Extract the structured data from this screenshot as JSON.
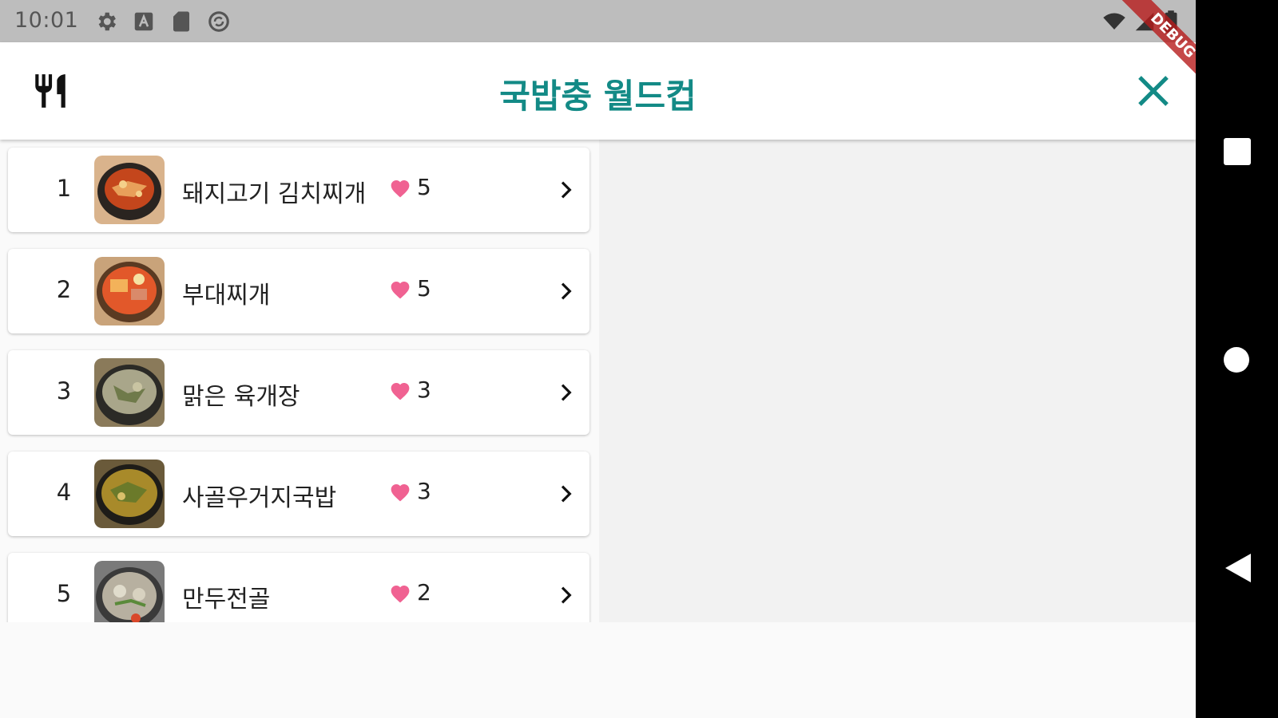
{
  "status_bar": {
    "time": "10:01",
    "left_icons": [
      "gear-icon",
      "a-icon",
      "sd-card-icon",
      "sync-icon"
    ],
    "right_icons": [
      "wifi-icon",
      "signal-icon",
      "battery-icon"
    ]
  },
  "app_bar": {
    "title": "국밥충 월드컵",
    "leading_icon": "restaurant-icon",
    "close_icon": "close-icon",
    "title_color": "#138a86"
  },
  "debug_banner": "DEBUG",
  "list": {
    "items": [
      {
        "rank": "1",
        "name": "돼지고기 김치찌개",
        "likes": "5"
      },
      {
        "rank": "2",
        "name": "부대찌개",
        "likes": "5"
      },
      {
        "rank": "3",
        "name": "맑은 육개장",
        "likes": "3"
      },
      {
        "rank": "4",
        "name": "사골우거지국밥",
        "likes": "3"
      },
      {
        "rank": "5",
        "name": "만두전골",
        "likes": "2"
      }
    ]
  },
  "colors": {
    "accent": "#138a86",
    "heart": "#f06292",
    "debug": "#b71c1c"
  },
  "nav_bar": {
    "buttons": [
      "recents-icon",
      "home-icon",
      "back-icon"
    ]
  }
}
